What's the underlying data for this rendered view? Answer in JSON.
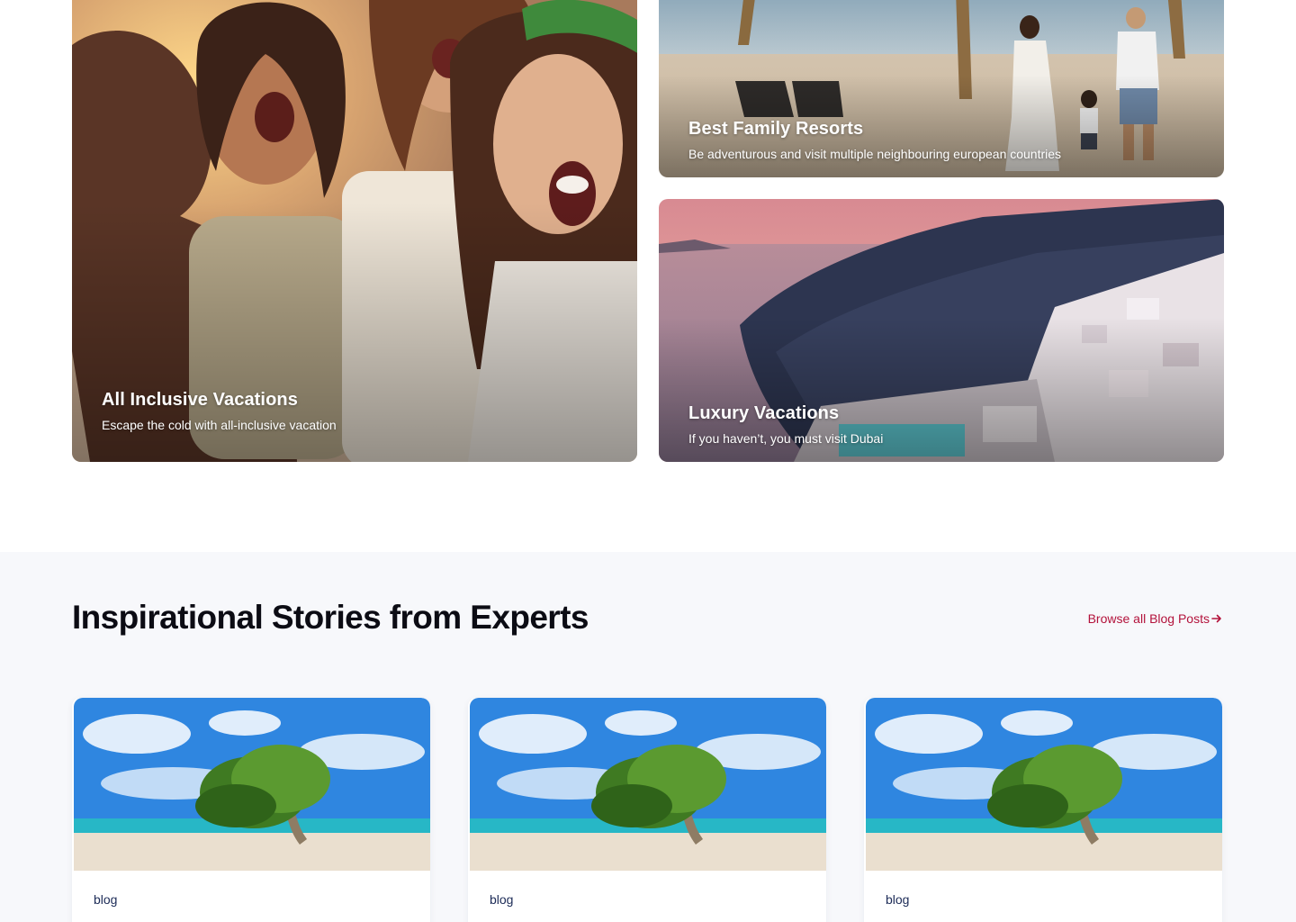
{
  "vacations": [
    {
      "title": "All Inclusive Vacations",
      "subtitle": "Escape the cold with all-inclusive vacation"
    },
    {
      "title": "Best Family Resorts",
      "subtitle": "Be adventurous and visit multiple neighbouring european countries"
    },
    {
      "title": "Luxury Vacations",
      "subtitle": "If you haven’t, you must visit Dubai"
    }
  ],
  "stories": {
    "heading": "Inspirational Stories from Experts",
    "browse_label": "Browse all Blog Posts",
    "posts": [
      {
        "tag": "blog"
      },
      {
        "tag": "blog"
      },
      {
        "tag": "blog"
      }
    ]
  },
  "colors": {
    "accent": "#b3123b",
    "section_bg": "#f7f8fb",
    "tag_text": "#1c2b57",
    "heading": "#0c0c14"
  },
  "icons": {
    "browse_arrow": "arrow-right-icon"
  }
}
